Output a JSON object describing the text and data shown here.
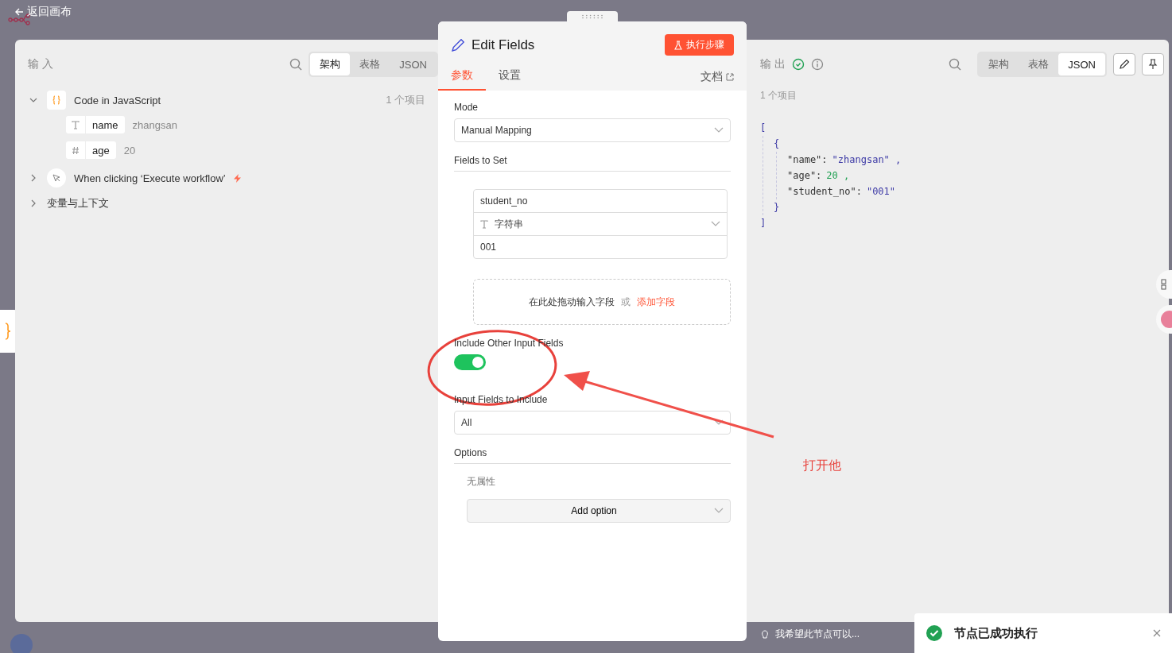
{
  "back_link": "返回画布",
  "input_panel": {
    "title": "输 入",
    "view_tabs": [
      {
        "label": "架构",
        "selected": true
      },
      {
        "label": "表格",
        "selected": false
      },
      {
        "label": "JSON",
        "selected": false
      }
    ],
    "tree": [
      {
        "kind": "code",
        "label": "Code in JavaScript",
        "count": "1 个项目",
        "expanded": true,
        "children": [
          {
            "kind": "string",
            "name": "name",
            "value": "zhangsan"
          },
          {
            "kind": "number",
            "name": "age",
            "value": "20"
          }
        ]
      },
      {
        "kind": "trigger",
        "label": "When clicking ‘Execute workflow’",
        "expanded": false
      },
      {
        "kind": "group",
        "label": "变量与上下文",
        "expanded": false
      }
    ]
  },
  "editor": {
    "title": "Edit Fields",
    "run_button": "执行步骤",
    "tabs": [
      {
        "label": "参数",
        "selected": true
      },
      {
        "label": "设置",
        "selected": false
      }
    ],
    "docs_link": "文档",
    "mode": {
      "label": "Mode",
      "value": "Manual Mapping"
    },
    "fields_to_set": {
      "label": "Fields to Set",
      "fields": [
        {
          "name": "student_no",
          "type": "字符串",
          "value": "001"
        }
      ]
    },
    "drop_zone": {
      "text": "在此处拖动输入字段",
      "separator": "或",
      "link": "添加字段"
    },
    "include_other": {
      "label": "Include Other Input Fields",
      "on": true
    },
    "input_fields": {
      "label": "Input Fields to Include",
      "value": "All"
    },
    "options": {
      "label": "Options",
      "empty": "无属性",
      "add_button": "Add option"
    }
  },
  "output_panel": {
    "title": "输 出",
    "view_tabs": [
      {
        "label": "架构",
        "selected": false
      },
      {
        "label": "表格",
        "selected": false
      },
      {
        "label": "JSON",
        "selected": true
      }
    ],
    "count": "1 个项目",
    "json": {
      "open_array": "[",
      "open_object": "{",
      "close_object": "}",
      "close_array": "]",
      "entries": [
        {
          "key": "\"name\":",
          "value": "\"zhangsan\"",
          "kind": "string",
          "suffix": ","
        },
        {
          "key": "\"age\":",
          "value": "20",
          "kind": "number",
          "suffix": ","
        },
        {
          "key": "\"student_no\":",
          "value": "\"001\"",
          "kind": "string"
        }
      ]
    }
  },
  "hint": "我希望此节点可以...",
  "toast": {
    "text": "节点已成功执行"
  },
  "annotation": {
    "text": "打开他"
  }
}
